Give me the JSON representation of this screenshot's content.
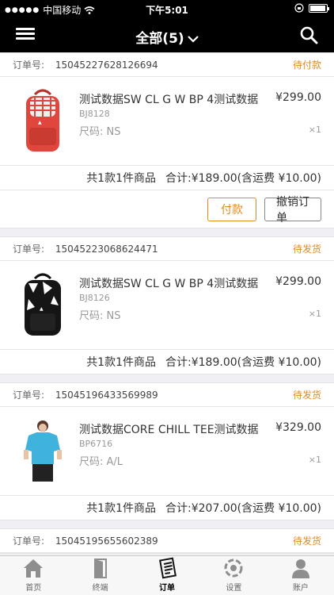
{
  "status_bar": {
    "carrier": "中国移动",
    "time": "下午5:01"
  },
  "header": {
    "title": "全部(5)"
  },
  "labels": {
    "order_no": "订单号:",
    "size_prefix": "尺码:",
    "summary_prefix": "共1款1件商品",
    "total_label": "合计:",
    "pay_button": "付款",
    "cancel_button": "撤销订单"
  },
  "orders": [
    {
      "number": "15045227628126694",
      "status": "待付款",
      "product_name": "测试数据SW CL G W BP 4测试数据",
      "price": "¥299.00",
      "sku": "BJ8128",
      "size": "NS",
      "qty": "×1",
      "total": "¥189.00(含运费 ¥10.00)",
      "image": "red-backpack"
    },
    {
      "number": "15045223068624471",
      "status": "待发货",
      "product_name": "测试数据SW CL G W BP 4测试数据",
      "price": "¥299.00",
      "sku": "BJ8126",
      "size": "NS",
      "qty": "×1",
      "total": "¥189.00(含运费 ¥10.00)",
      "image": "black-backpack"
    },
    {
      "number": "15045196433569989",
      "status": "待发货",
      "product_name": "测试数据CORE CHILL TEE测试数据",
      "price": "¥329.00",
      "sku": "BP6716",
      "size": "A/L",
      "qty": "×1",
      "total": "¥207.00(含运费 ¥10.00)",
      "image": "blue-tee"
    },
    {
      "number": "15045195655602389",
      "status": "待发货"
    }
  ],
  "tabs": [
    {
      "label": "首页",
      "icon": "home-icon"
    },
    {
      "label": "终端",
      "icon": "door-icon"
    },
    {
      "label": "订单",
      "icon": "order-icon",
      "active": true
    },
    {
      "label": "设置",
      "icon": "settings-icon"
    },
    {
      "label": "账户",
      "icon": "person-icon"
    }
  ],
  "colors": {
    "accent": "#e38b1e",
    "header_bg": "#000000"
  }
}
